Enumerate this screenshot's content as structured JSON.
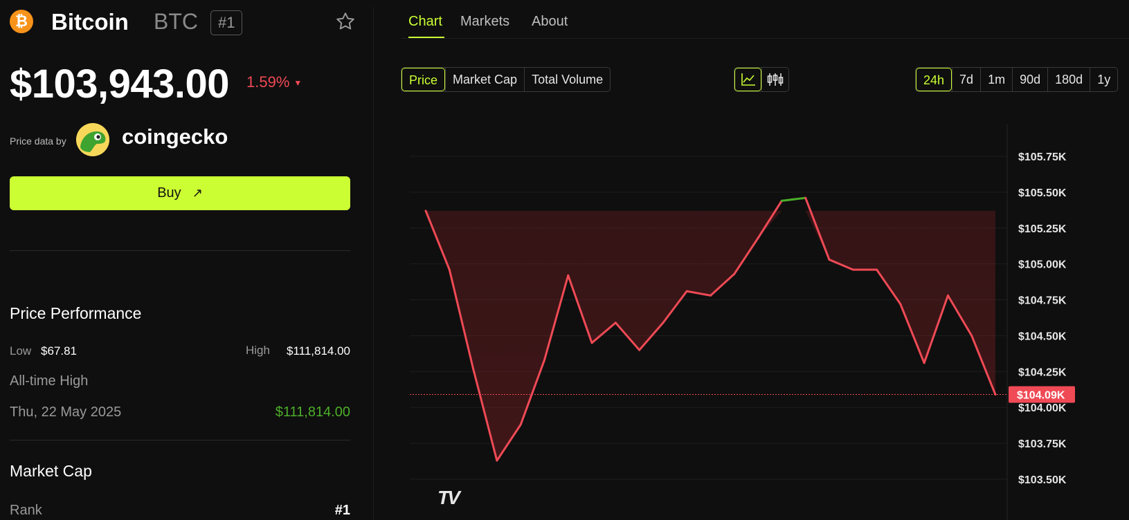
{
  "coin": {
    "name": "Bitcoin",
    "symbol": "BTC",
    "rank_badge": "#1",
    "logo_glyph": "₿",
    "logo_color": "#f7931a",
    "price": "$103,943.00",
    "change": "1.59%",
    "change_direction": "down",
    "change_arrow": "▼"
  },
  "attribution": {
    "label": "Price data by",
    "provider": "coingecko"
  },
  "buy": {
    "label": "Buy",
    "arrow": "↗"
  },
  "performance": {
    "title": "Price Performance",
    "low_label": "Low",
    "low_value": "$67.81",
    "high_label": "High",
    "high_value": "$111,814.00",
    "ath_label": "All-time High",
    "ath_date": "Thu, 22 May 2025",
    "ath_value": "$111,814.00"
  },
  "market_cap": {
    "title": "Market Cap",
    "rank_label": "Rank",
    "rank_value": "#1"
  },
  "tabs": [
    {
      "label": "Chart",
      "active": true
    },
    {
      "label": "Markets",
      "active": false
    },
    {
      "label": "About",
      "active": false
    }
  ],
  "metric_options": [
    {
      "label": "Price",
      "active": true
    },
    {
      "label": "Market Cap",
      "active": false
    },
    {
      "label": "Total Volume",
      "active": false
    }
  ],
  "chart_type_options": [
    {
      "icon": "line-chart-icon",
      "active": true
    },
    {
      "icon": "candlestick-icon",
      "active": false
    }
  ],
  "range_options": [
    {
      "label": "24h",
      "active": true
    },
    {
      "label": "7d",
      "active": false
    },
    {
      "label": "1m",
      "active": false
    },
    {
      "label": "90d",
      "active": false
    },
    {
      "label": "180d",
      "active": false
    },
    {
      "label": "1y",
      "active": false
    }
  ],
  "colors": {
    "accent": "#ccff33",
    "down": "#ef4a55",
    "up": "#4caf2a",
    "background": "#0f0f0f"
  },
  "chart_data": {
    "type": "line",
    "ylim": [
      103.5,
      106.0
    ],
    "y_unit": "thousand USD",
    "yticks": [
      105.75,
      105.5,
      105.25,
      105.0,
      104.75,
      104.5,
      104.25,
      104.0,
      103.75,
      103.5
    ],
    "ytick_labels": [
      "$105.75K",
      "$105.50K",
      "$105.25K",
      "$105.00K",
      "$104.75K",
      "$104.50K",
      "$104.25K",
      "$104.00K",
      "$103.75K",
      "$103.50K"
    ],
    "current_value": 104.09,
    "current_label": "$104.09K",
    "baseline": 105.37,
    "grid": true,
    "series": [
      {
        "values": [
          105.37,
          104.96,
          104.27,
          103.63,
          103.88,
          104.33,
          104.92,
          104.45,
          104.59,
          104.4,
          104.59,
          104.81,
          104.78,
          104.93,
          105.18,
          105.44,
          105.46,
          105.03,
          104.96,
          104.96,
          104.72,
          104.31,
          104.78,
          104.5,
          104.09
        ]
      }
    ],
    "watermark": "TV"
  }
}
